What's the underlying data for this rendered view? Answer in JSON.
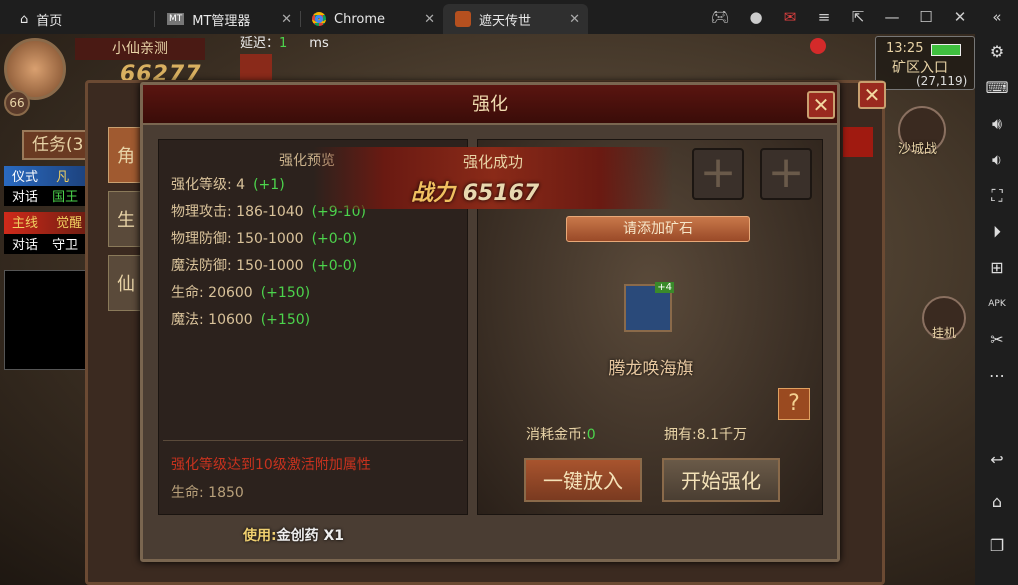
{
  "tabs": [
    {
      "label": "首页",
      "icon": "home-icon"
    },
    {
      "label": "MT管理器",
      "icon": "mt-app-icon"
    },
    {
      "label": "Chrome",
      "icon": "chrome-icon"
    },
    {
      "label": "遮天传世",
      "icon": "game-icon",
      "active": true
    }
  ],
  "window_controls": [
    "gamepad-icon",
    "account-icon",
    "mail-icon",
    "menu-icon",
    "popout-icon",
    "minimize-icon",
    "maximize-icon",
    "close-icon",
    "collapse-sidebar-icon"
  ],
  "sidebar": [
    "settings-icon",
    "keyboard-icon",
    "volume-up-icon",
    "volume-down-icon",
    "screenshot-icon",
    "record-icon",
    "add-app-icon",
    "apk-icon",
    "scissors-icon",
    "more-icon",
    "back-icon",
    "home-icon",
    "recents-icon"
  ],
  "hud": {
    "player_name": "小仙亲测",
    "level": "66",
    "power_partial": "66277",
    "latency_label": "延迟：",
    "latency_value": "1",
    "latency_unit": "ms",
    "time": "13:25",
    "location": "矿区入口",
    "coords": "(27,119)",
    "siege_label": "沙城战",
    "idle_label": "挂机",
    "battery_color": "#3fbf3f"
  },
  "quest": {
    "tab": "任务(3",
    "items": [
      {
        "tag": "仪式",
        "text": "凡",
        "action": "对话",
        "target": "国王"
      },
      {
        "tag": "主线",
        "text": "觉醒",
        "action": "对话",
        "target": "守卫"
      }
    ]
  },
  "back_panel": {
    "title": "角色",
    "side_tabs": [
      "角",
      "生",
      "仙"
    ]
  },
  "dialog": {
    "title": "强化",
    "preview_title": "强化预览",
    "stats": [
      {
        "label": "强化等级:",
        "value": "4",
        "bonus": "(+1)"
      },
      {
        "label": "物理攻击:",
        "value": "186-1040",
        "bonus": "(+9-10)"
      },
      {
        "label": "物理防御:",
        "value": "150-1000",
        "bonus": "(+0-0)"
      },
      {
        "label": "魔法防御:",
        "value": "150-1000",
        "bonus": "(+0-0)"
      },
      {
        "label": "生命:",
        "value": "20600",
        "bonus": "(+150)"
      },
      {
        "label": "魔法:",
        "value": "10600",
        "bonus": "(+150)"
      }
    ],
    "bonus_note": "强化等级达到10级激活附加属性",
    "bonus_stat": "生命: 1850",
    "use_prefix": "使用:",
    "use_item": "金创药 X1",
    "success_text": "强化成功",
    "power_label": "战力",
    "power_value": "65167",
    "add_ore": "请添加矿石",
    "item_name": "腾龙唤海旗",
    "item_level": "+4",
    "help": "?",
    "cost_label": "消耗金币:",
    "cost_value": "0",
    "owned": "拥有:8.1千万",
    "btn_auto": "一键放入",
    "btn_start": "开始强化"
  }
}
